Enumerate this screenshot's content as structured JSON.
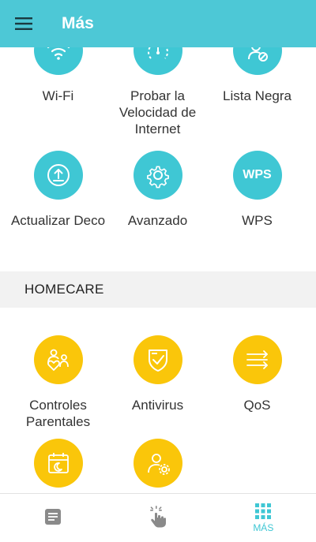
{
  "header": {
    "title": "Más",
    "color": "#4dc8d6"
  },
  "tools": [
    {
      "label": "Wi-Fi",
      "icon": "wifi-icon"
    },
    {
      "label": "Probar la Velocidad de Internet",
      "icon": "speedometer-icon"
    },
    {
      "label": "Lista Negra",
      "icon": "blocked-user-icon"
    },
    {
      "label": "Actualizar Deco",
      "icon": "update-icon"
    },
    {
      "label": "Avanzado",
      "icon": "gear-icon"
    },
    {
      "label": "WPS",
      "icon": "wps-icon",
      "icon_text": "WPS"
    }
  ],
  "homecare": {
    "title": "HOMECARE",
    "items": [
      {
        "label": "Controles Parentales",
        "icon": "parental-controls-icon"
      },
      {
        "label": "Antivirus",
        "icon": "shield-icon"
      },
      {
        "label": "QoS",
        "icon": "qos-arrows-icon"
      },
      {
        "label": "",
        "icon": "calendar-icon"
      },
      {
        "label": "",
        "icon": "user-settings-icon"
      }
    ]
  },
  "tabbar": {
    "tabs": [
      {
        "label": "",
        "icon": "document-icon"
      },
      {
        "label": "",
        "icon": "touch-hand-icon"
      },
      {
        "label": "MÁS",
        "icon": "grid-icon",
        "active": true
      }
    ]
  },
  "colors": {
    "accent": "#3fc7d4",
    "homecare": "#fac60a",
    "section_bg": "#f2f2f2"
  }
}
